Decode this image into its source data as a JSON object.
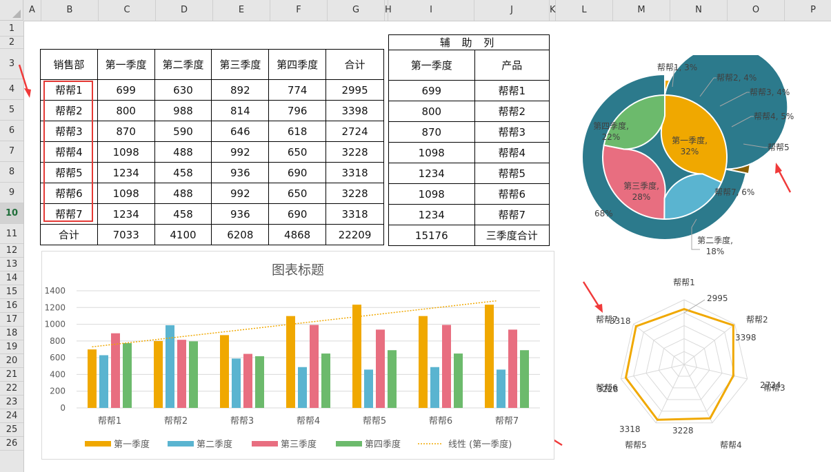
{
  "columns": [
    "A",
    "B",
    "C",
    "D",
    "E",
    "F",
    "G",
    "H",
    "I",
    "J",
    "K",
    "L",
    "M",
    "N",
    "O",
    "P"
  ],
  "rows": [
    "1",
    "2",
    "3",
    "4",
    "5",
    "6",
    "7",
    "8",
    "9",
    "10",
    "11",
    "12",
    "13",
    "14",
    "15",
    "16",
    "17",
    "18",
    "19",
    "20",
    "21",
    "22",
    "23",
    "24",
    "25",
    "26"
  ],
  "active_row": "10",
  "main_table": {
    "headers": [
      "销售部",
      "第一季度",
      "第二季度",
      "第三季度",
      "第四季度",
      "合计"
    ],
    "rows": [
      [
        "帮帮1",
        "699",
        "630",
        "892",
        "774",
        "2995"
      ],
      [
        "帮帮2",
        "800",
        "988",
        "814",
        "796",
        "3398"
      ],
      [
        "帮帮3",
        "870",
        "590",
        "646",
        "618",
        "2724"
      ],
      [
        "帮帮4",
        "1098",
        "488",
        "992",
        "650",
        "3228"
      ],
      [
        "帮帮5",
        "1234",
        "458",
        "936",
        "690",
        "3318"
      ],
      [
        "帮帮6",
        "1098",
        "488",
        "992",
        "650",
        "3228"
      ],
      [
        "帮帮7",
        "1234",
        "458",
        "936",
        "690",
        "3318"
      ]
    ],
    "total_row": [
      "合计",
      "7033",
      "4100",
      "6208",
      "4868",
      "22209"
    ]
  },
  "aux_table": {
    "title": "辅 助 列",
    "headers": [
      "第一季度",
      "产品"
    ],
    "rows": [
      [
        "699",
        "帮帮1"
      ],
      [
        "800",
        "帮帮2"
      ],
      [
        "870",
        "帮帮3"
      ],
      [
        "1098",
        "帮帮4"
      ],
      [
        "1234",
        "帮帮5"
      ],
      [
        "1098",
        "帮帮6"
      ],
      [
        "1234",
        "帮帮7"
      ]
    ],
    "total_row": [
      "15176",
      "三季度合计"
    ]
  },
  "colors": {
    "q1": "#f0a800",
    "q2": "#5ab4d0",
    "q3": "#e86e80",
    "q4": "#6cba6c",
    "outer5": "#e88a50",
    "outer7": "#8a6000",
    "outer_total": "#2c7a8c",
    "arrow": "#f03a3a",
    "radar": "#f0a800"
  },
  "chart_data": [
    {
      "type": "bar",
      "title": "图表标题",
      "categories": [
        "帮帮1",
        "帮帮2",
        "帮帮3",
        "帮帮4",
        "帮帮5",
        "帮帮6",
        "帮帮7"
      ],
      "series": [
        {
          "name": "第一季度",
          "values": [
            699,
            800,
            870,
            1098,
            1234,
            1098,
            1234
          ]
        },
        {
          "name": "第二季度",
          "values": [
            630,
            988,
            590,
            488,
            458,
            488,
            458
          ]
        },
        {
          "name": "第三季度",
          "values": [
            892,
            814,
            646,
            992,
            936,
            992,
            936
          ]
        },
        {
          "name": "第四季度",
          "values": [
            774,
            796,
            618,
            650,
            690,
            650,
            690
          ]
        }
      ],
      "trendline": {
        "name": "线性 (第一季度)"
      },
      "ylim": [
        0,
        1400
      ],
      "yticks": [
        0,
        200,
        400,
        600,
        800,
        1000,
        1200,
        1400
      ],
      "grid": true,
      "legend": "bottom"
    },
    {
      "type": "pie",
      "subtype": "doughnut",
      "inner": [
        {
          "label": "第一季度",
          "value": 7033,
          "pct": "32%"
        },
        {
          "label": "第二季度",
          "value": 4100,
          "pct": "18%"
        },
        {
          "label": "第三季度",
          "value": 6208,
          "pct": "28%"
        },
        {
          "label": "第四季度",
          "value": 4868,
          "pct": "22%"
        }
      ],
      "outer": [
        {
          "label": "帮帮1",
          "value": 699,
          "text": "帮帮1, 3%"
        },
        {
          "label": "帮帮2",
          "value": 800,
          "text": "帮帮2, 4%"
        },
        {
          "label": "帮帮3",
          "value": 870,
          "text": "帮帮3, 4%"
        },
        {
          "label": "帮帮4",
          "value": 1098,
          "text": "帮帮4, 5%"
        },
        {
          "label": "帮帮5",
          "value": 1234,
          "text": "帮帮5"
        },
        {
          "label": "帮帮7",
          "value": 1234,
          "text": "帮帮7, 6%"
        },
        {
          "label": "",
          "value": 15176,
          "text": "68%"
        }
      ]
    },
    {
      "type": "radar",
      "categories": [
        "帮帮1",
        "帮帮2",
        "帮帮3",
        "帮帮4",
        "帮帮5",
        "帮帮6",
        "帮帮7"
      ],
      "values": [
        2995,
        3398,
        2724,
        3228,
        3318,
        3228,
        3318
      ],
      "value_labels": [
        "2995",
        "3398",
        "2724",
        "3228",
        "3318",
        "3228",
        "3318"
      ],
      "rlim": [
        0,
        3500
      ]
    }
  ]
}
